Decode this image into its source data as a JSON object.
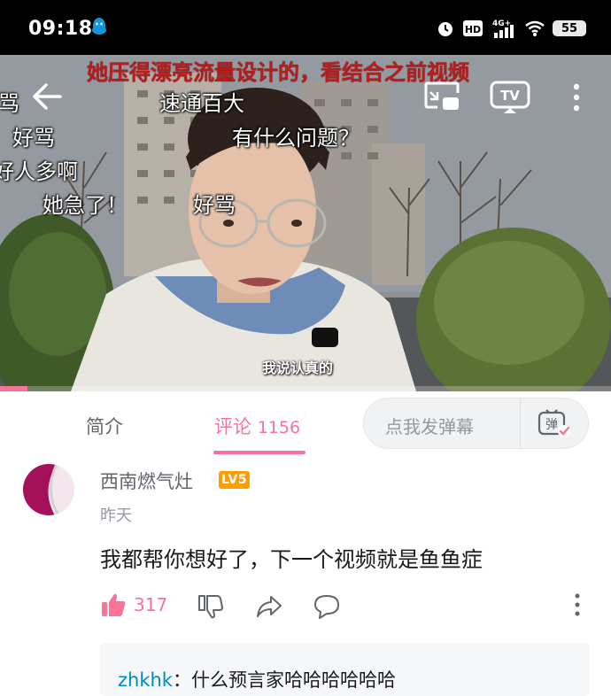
{
  "status_bar": {
    "time": "09:18",
    "app_icon": "qq-penguin-icon",
    "battery": "55",
    "icons": [
      "alarm-icon",
      "hd-icon",
      "4g-signal-icon",
      "wifi-icon",
      "battery-icon"
    ],
    "network_label": "4G+",
    "hd_label": "HD"
  },
  "video": {
    "top_caption": "她压得漂亮流量设计的，看结合之前视频",
    "subtitle": "我说认真的",
    "danmaku": [
      "骂",
      "速通百大",
      "好骂",
      "有什么问题？",
      "好人多啊",
      "她急了！",
      "好骂"
    ],
    "buttons": {
      "back": "back-arrow-icon",
      "cast": "cast-screen-icon",
      "tv": "TV",
      "more": "more-vertical-icon"
    },
    "progress": 0.045
  },
  "tabs": {
    "intro": "简介",
    "comments": "评论",
    "comment_count": "1156",
    "danmu_placeholder": "点我发弹幕",
    "danmu_toggle_label": "弹"
  },
  "comment": {
    "username": "西南燃气灶",
    "level": "LV5",
    "time": "昨天",
    "text": "我都帮你想好了，下一个视频就是鱼鱼症",
    "likes": "317",
    "reply_preview": {
      "user": "zhkhk",
      "text": "：什么预言家哈哈哈哈哈哈"
    }
  },
  "colors": {
    "accent": "#fb7299",
    "level_badge": "#ff9c00",
    "reply_user": "#008ac5",
    "caption_red": "#b81d1d"
  }
}
